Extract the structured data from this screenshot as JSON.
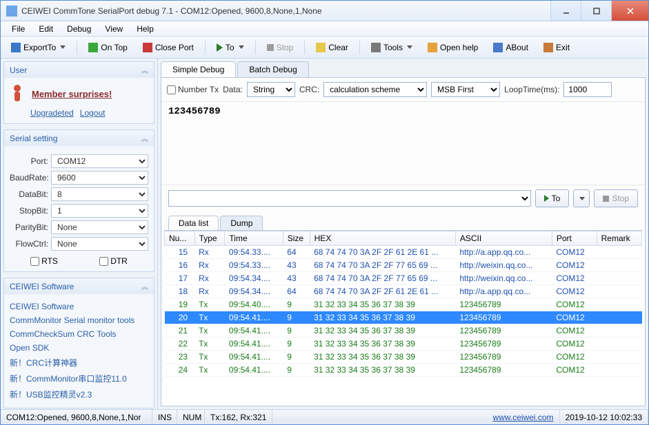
{
  "window": {
    "title": "CEIWEI CommTone SerialPort debug 7.1 - COM12:Opened, 9600,8,None,1,None"
  },
  "menu": [
    "File",
    "Edit",
    "Debug",
    "View",
    "Help"
  ],
  "toolbar": {
    "export": "ExportTo",
    "ontop": "On Top",
    "closeport": "Close Port",
    "to": "To",
    "stop": "Stop",
    "clear": "Clear",
    "tools": "Tools",
    "openhelp": "Open help",
    "about": "ABout",
    "exit": "Exit"
  },
  "left": {
    "user": {
      "title": "User",
      "member": "Member surprises!",
      "upgraded": "Upgradeted",
      "logout": "Logout"
    },
    "serial": {
      "title": "Serial setting",
      "port_lbl": "Port:",
      "port": "COM12",
      "baud_lbl": "BaudRate:",
      "baud": "9600",
      "databit_lbl": "DataBit:",
      "databit": "8",
      "stopbit_lbl": "StopBit:",
      "stopbit": "1",
      "parity_lbl": "ParityBit:",
      "parity": "None",
      "flow_lbl": "FlowCtrl:",
      "flow": "None",
      "rts": "RTS",
      "dtr": "DTR"
    },
    "software": {
      "title": "CEIWEI Software",
      "links": [
        "CEIWEI Software",
        "CommMonitor Serial monitor tools",
        "CommCheckSum CRC Tools",
        "Open SDK",
        "新！CRC计算神器",
        "新！CommMonitor串口监控11.0",
        "新！USB监控精灵v2.3"
      ]
    }
  },
  "tabs": {
    "simple": "Simple Debug",
    "batch": "Batch Debug"
  },
  "cfg": {
    "numbertx": "Number Tx",
    "data_lbl": "Data:",
    "data_val": "String",
    "crc_lbl": "CRC:",
    "crc_val": "calculation scheme",
    "msb_val": "MSB First",
    "loop_lbl": "LoopTime(ms):",
    "loop_val": "1000"
  },
  "dataview": "123456789",
  "midbtn": {
    "to": "To",
    "stop": "Stop"
  },
  "bottabs": {
    "datalist": "Data list",
    "dump": "Dump"
  },
  "gridcols": [
    "Nu...",
    "Type",
    "Time",
    "Size",
    "HEX",
    "ASCII",
    "Port",
    "Remark"
  ],
  "rows": [
    {
      "n": 15,
      "type": "Rx",
      "time": "09:54.33....",
      "size": "64",
      "hex": "68 74 74 70 3A 2F 2F 61 2E 61 ...",
      "ascii": "http://a.app.qq.co...",
      "port": "COM12",
      "dir": "rx"
    },
    {
      "n": 16,
      "type": "Rx",
      "time": "09:54.33....",
      "size": "43",
      "hex": "68 74 74 70 3A 2F 2F 77 65 69 ...",
      "ascii": "http://weixin.qq.co...",
      "port": "COM12",
      "dir": "rx"
    },
    {
      "n": 17,
      "type": "Rx",
      "time": "09:54.34....",
      "size": "43",
      "hex": "68 74 74 70 3A 2F 2F 77 65 69 ...",
      "ascii": "http://weixin.qq.co...",
      "port": "COM12",
      "dir": "rx"
    },
    {
      "n": 18,
      "type": "Rx",
      "time": "09:54.34....",
      "size": "64",
      "hex": "68 74 74 70 3A 2F 2F 61 2E 61 ...",
      "ascii": "http://a.app.qq.co...",
      "port": "COM12",
      "dir": "rx"
    },
    {
      "n": 19,
      "type": "Tx",
      "time": "09:54.40....",
      "size": "9",
      "hex": "31 32 33 34 35 36 37 38 39",
      "ascii": "123456789",
      "port": "COM12",
      "dir": "tx"
    },
    {
      "n": 20,
      "type": "Tx",
      "time": "09:54.41....",
      "size": "9",
      "hex": "31 32 33 34 35 36 37 38 39",
      "ascii": "123456789",
      "port": "COM12",
      "dir": "tx",
      "sel": true
    },
    {
      "n": 21,
      "type": "Tx",
      "time": "09:54.41....",
      "size": "9",
      "hex": "31 32 33 34 35 36 37 38 39",
      "ascii": "123456789",
      "port": "COM12",
      "dir": "tx"
    },
    {
      "n": 22,
      "type": "Tx",
      "time": "09:54.41....",
      "size": "9",
      "hex": "31 32 33 34 35 36 37 38 39",
      "ascii": "123456789",
      "port": "COM12",
      "dir": "tx"
    },
    {
      "n": 23,
      "type": "Tx",
      "time": "09:54.41....",
      "size": "9",
      "hex": "31 32 33 34 35 36 37 38 39",
      "ascii": "123456789",
      "port": "COM12",
      "dir": "tx"
    },
    {
      "n": 24,
      "type": "Tx",
      "time": "09:54.41....",
      "size": "9",
      "hex": "31 32 33 34 35 36 37 38 39",
      "ascii": "123456789",
      "port": "COM12",
      "dir": "tx"
    }
  ],
  "status": {
    "port": "COM12:Opened, 9600,8,None,1,Nor",
    "ins": "INS",
    "num": "NUM",
    "txrx": "Tx:162, Rx:321",
    "url": "www.ceiwei.com",
    "time": "2019-10-12 10:02:33"
  }
}
